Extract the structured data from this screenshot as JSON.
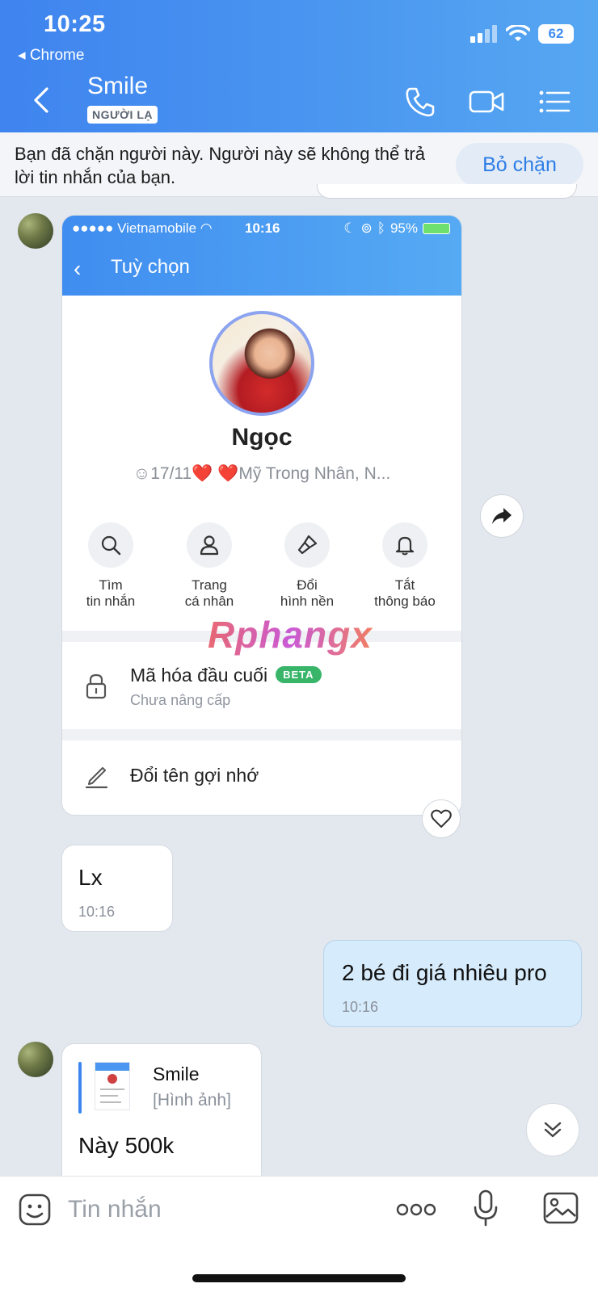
{
  "status_bar": {
    "time": "10:25",
    "back_app": "Chrome",
    "battery": "62"
  },
  "header": {
    "name": "Smile",
    "badge": "NGƯỜI LẠ"
  },
  "blocked_banner": {
    "text": "Bạn đã chặn người này. Người này sẽ không thể trả lời tin nhắn của bạn.",
    "button": "Bỏ chặn"
  },
  "shared_screenshot": {
    "carrier": "●●●●● Vietnamobile",
    "time": "10:16",
    "battery": "95%",
    "title": "Tuỳ chọn",
    "profile_name": "Ngọc",
    "profile_status": "☺17/11❤️ ❤️Mỹ Trong Nhân, N...",
    "actions": [
      {
        "line1": "Tìm",
        "line2": "tin nhắn"
      },
      {
        "line1": "Trang",
        "line2": "cá nhân"
      },
      {
        "line1": "Đổi",
        "line2": "hình nền"
      },
      {
        "line1": "Tắt",
        "line2": "thông báo"
      }
    ],
    "watermark": "Rphangx",
    "e2e_title": "Mã hóa đầu cuối",
    "e2e_badge": "BETA",
    "e2e_sub": "Chưa nâng cấp",
    "rename": "Đổi tên gợi nhớ"
  },
  "messages": [
    {
      "text": "Lx",
      "time": "10:16"
    },
    {
      "text": "2 bé đi giá nhiêu pro",
      "time": "10:16"
    },
    {
      "quote_name": "Smile",
      "quote_sub": "[Hình ảnh]",
      "text": "Này 500k"
    }
  ],
  "input": {
    "placeholder": "Tin nhắn"
  },
  "colors": {
    "header": "#4a96f0",
    "outgoing_bubble": "#d6ebfb",
    "accent": "#2d7ee6",
    "beta": "#39b56a"
  }
}
